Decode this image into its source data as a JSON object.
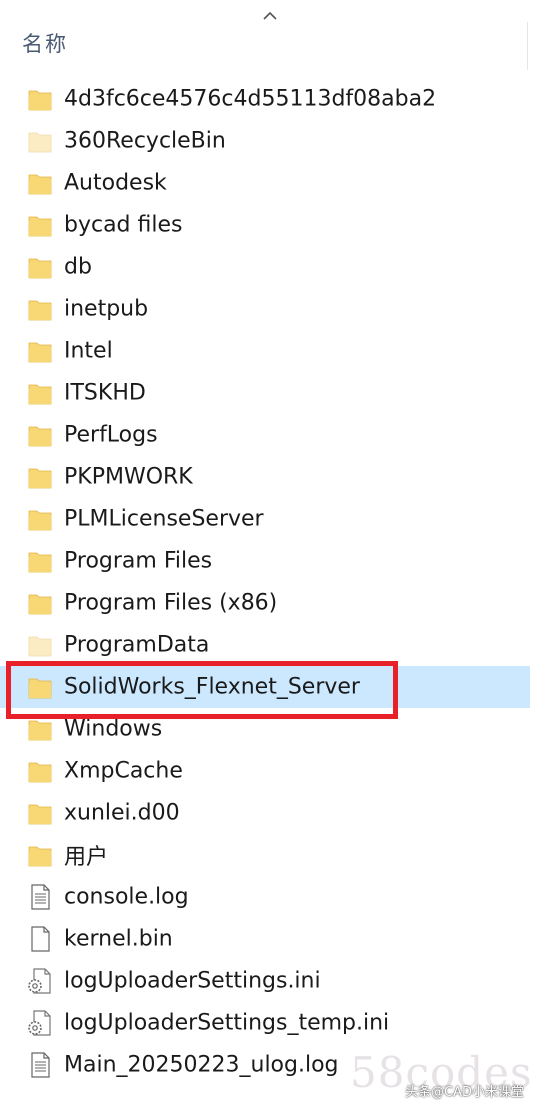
{
  "header": {
    "column_label": "名称"
  },
  "items": [
    {
      "name": "4d3fc6ce4576c4d55113df08aba2",
      "icon": "folder"
    },
    {
      "name": "360RecycleBin",
      "icon": "folder-hidden"
    },
    {
      "name": "Autodesk",
      "icon": "folder"
    },
    {
      "name": "bycad files",
      "icon": "folder"
    },
    {
      "name": "db",
      "icon": "folder"
    },
    {
      "name": "inetpub",
      "icon": "folder"
    },
    {
      "name": "Intel",
      "icon": "folder"
    },
    {
      "name": "ITSKHD",
      "icon": "folder"
    },
    {
      "name": "PerfLogs",
      "icon": "folder"
    },
    {
      "name": "PKPMWORK",
      "icon": "folder"
    },
    {
      "name": "PLMLicenseServer",
      "icon": "folder"
    },
    {
      "name": "Program Files",
      "icon": "folder"
    },
    {
      "name": "Program Files (x86)",
      "icon": "folder"
    },
    {
      "name": "ProgramData",
      "icon": "folder-hidden"
    },
    {
      "name": "SolidWorks_Flexnet_Server",
      "icon": "folder",
      "selected": true
    },
    {
      "name": "Windows",
      "icon": "folder"
    },
    {
      "name": "XmpCache",
      "icon": "folder"
    },
    {
      "name": "xunlei.d00",
      "icon": "folder"
    },
    {
      "name": "用户",
      "icon": "folder"
    },
    {
      "name": "console.log",
      "icon": "text-file"
    },
    {
      "name": "kernel.bin",
      "icon": "blank-file"
    },
    {
      "name": "logUploaderSettings.ini",
      "icon": "settings-file"
    },
    {
      "name": "logUploaderSettings_temp.ini",
      "icon": "settings-file"
    },
    {
      "name": "Main_20250223_ulog.log",
      "icon": "text-file"
    }
  ],
  "watermark": {
    "text": "58codes",
    "credit": "头条@CAD小米课堂"
  },
  "colors": {
    "folder": "#f8d775",
    "folder_hidden": "#fbecc4",
    "selection": "#cce8ff",
    "highlight": "#e8202a"
  }
}
